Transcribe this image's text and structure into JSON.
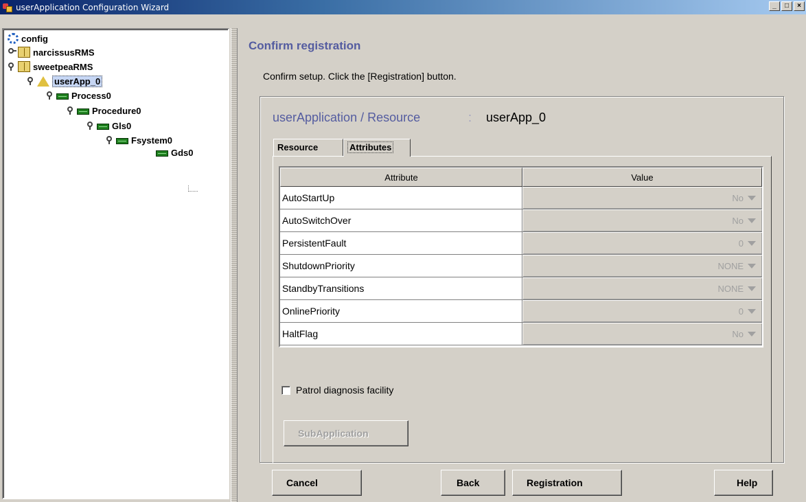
{
  "window": {
    "title": "userApplication Configuration Wizard",
    "controls": [
      "_",
      "□",
      "×"
    ]
  },
  "tree": {
    "nodes": [
      {
        "label": "config",
        "icon": "config-icon"
      },
      {
        "label": "narcissusRMS",
        "icon": "rms-node-icon"
      },
      {
        "label": "sweetpeaRMS",
        "icon": "rms-node-icon"
      },
      {
        "label": "userApp_0",
        "icon": "userapp-icon",
        "selected": true
      },
      {
        "label": "Process0",
        "icon": "resource-icon"
      },
      {
        "label": "Procedure0",
        "icon": "resource-icon"
      },
      {
        "label": "Gls0",
        "icon": "resource-icon"
      },
      {
        "label": "Fsystem0",
        "icon": "resource-icon"
      },
      {
        "label": "Gds0",
        "icon": "resource-icon"
      }
    ]
  },
  "main": {
    "title": "Confirm registration",
    "instructions": "Confirm setup.  Click the [Registration] button.",
    "ua_label": "userApplication / Resource",
    "ua_separator": ":",
    "ua_value": "userApp_0",
    "tabs": [
      {
        "label": "Resource"
      },
      {
        "label": "Attributes"
      }
    ],
    "table": {
      "headers": {
        "attribute": "Attribute",
        "value": "Value"
      },
      "rows": [
        {
          "attribute": "AutoStartUp",
          "value": "No"
        },
        {
          "attribute": "AutoSwitchOver",
          "value": "No"
        },
        {
          "attribute": "PersistentFault",
          "value": "0"
        },
        {
          "attribute": "ShutdownPriority",
          "value": "NONE"
        },
        {
          "attribute": "StandbyTransitions",
          "value": "NONE"
        },
        {
          "attribute": "OnlinePriority",
          "value": "0"
        },
        {
          "attribute": "HaltFlag",
          "value": "No"
        }
      ]
    },
    "patrol_label": "Patrol diagnosis facility",
    "subapp_label": "SubApplication"
  },
  "buttons": {
    "cancel": "Cancel",
    "back": "Back",
    "registration": "Registration",
    "help": "Help"
  }
}
